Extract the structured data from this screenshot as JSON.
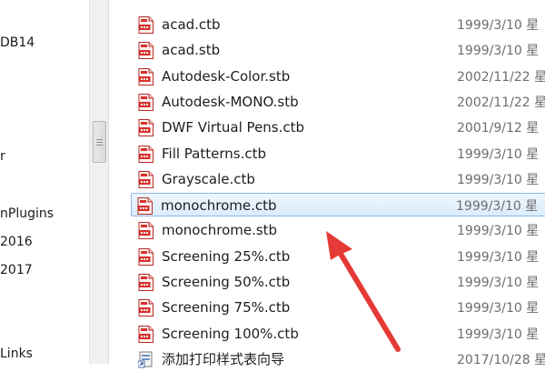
{
  "navigation_pane": {
    "items": [
      {
        "label": "DB14"
      },
      {
        "label": "r"
      },
      {
        "label": "nPlugins"
      },
      {
        "label": "2016"
      },
      {
        "label": "2017"
      },
      {
        "label": "Links"
      }
    ]
  },
  "file_list": {
    "rows": [
      {
        "name": "acad.ctb",
        "date": "1999/3/10 星",
        "icon": "ctb-file-icon",
        "selected": false
      },
      {
        "name": "acad.stb",
        "date": "1999/3/10 星",
        "icon": "stb-file-icon",
        "selected": false
      },
      {
        "name": "Autodesk-Color.stb",
        "date": "2002/11/22 星",
        "icon": "stb-file-icon",
        "selected": false
      },
      {
        "name": "Autodesk-MONO.stb",
        "date": "2002/11/22 星",
        "icon": "stb-file-icon",
        "selected": false
      },
      {
        "name": "DWF Virtual Pens.ctb",
        "date": "2001/9/12 星",
        "icon": "ctb-file-icon",
        "selected": false
      },
      {
        "name": "Fill Patterns.ctb",
        "date": "1999/3/10 星",
        "icon": "ctb-file-icon",
        "selected": false
      },
      {
        "name": "Grayscale.ctb",
        "date": "1999/3/10 星",
        "icon": "ctb-file-icon",
        "selected": false
      },
      {
        "name": "monochrome.ctb",
        "date": "1999/3/10 星",
        "icon": "ctb-file-icon",
        "selected": true
      },
      {
        "name": "monochrome.stb",
        "date": "1999/3/10 星",
        "icon": "stb-file-icon",
        "selected": false
      },
      {
        "name": "Screening 25%.ctb",
        "date": "1999/3/10 星",
        "icon": "ctb-file-icon",
        "selected": false
      },
      {
        "name": "Screening 50%.ctb",
        "date": "1999/3/10 星",
        "icon": "ctb-file-icon",
        "selected": false
      },
      {
        "name": "Screening 75%.ctb",
        "date": "1999/3/10 星",
        "icon": "ctb-file-icon",
        "selected": false
      },
      {
        "name": "Screening 100%.ctb",
        "date": "1999/3/10 星",
        "icon": "ctb-file-icon",
        "selected": false
      },
      {
        "name": "添加打印样式表向导",
        "date": "2017/10/28 星",
        "icon": "shortcut-icon",
        "selected": false
      }
    ]
  },
  "colors": {
    "selection_border": "#8fb8e6",
    "selection_fill": "#dcecfc",
    "arrow": "#e53935",
    "icon_red": "#d9302b",
    "date_text": "#6d6d6d"
  }
}
